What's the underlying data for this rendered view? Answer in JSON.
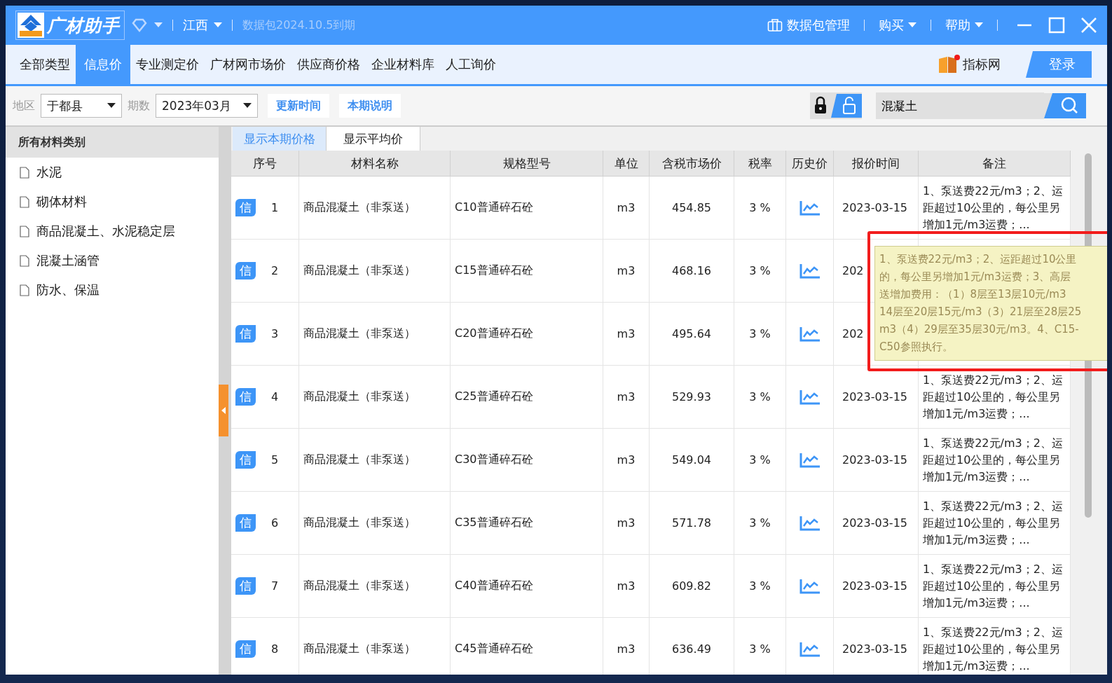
{
  "app": {
    "logo_text": "广材助手",
    "region": "江西",
    "package_notice": "数据包2024.10.5到期",
    "menu": [
      {
        "label": "数据包管理",
        "kind": "icon"
      },
      {
        "label": "购买",
        "kind": "dropdown"
      },
      {
        "label": "帮助",
        "kind": "dropdown"
      }
    ]
  },
  "nav": {
    "tabs": [
      {
        "label": "全部类型",
        "selected": false
      },
      {
        "label": "信息价",
        "selected": true
      },
      {
        "label": "专业测定价",
        "selected": false
      },
      {
        "label": "广材网市场价",
        "selected": false
      },
      {
        "label": "供应商价格",
        "selected": false
      },
      {
        "label": "企业材料库",
        "selected": false
      },
      {
        "label": "人工询价",
        "selected": false
      }
    ],
    "index_link": "指标网",
    "login": "登录"
  },
  "filters": {
    "region_label": "地区",
    "region": "于都县",
    "period_label": "期数",
    "period": "2023年03月",
    "buttons": [
      "更新时间",
      "本期说明"
    ],
    "search": "混凝土"
  },
  "sidebar": {
    "title": "所有材料类别",
    "items": [
      "水泥",
      "砌体材料",
      "商品混凝土、水泥稳定层",
      "混凝土涵管",
      "防水、保温"
    ]
  },
  "view_tabs": [
    {
      "label": "显示本期价格",
      "selected": true
    },
    {
      "label": "显示平均价",
      "selected": false
    }
  ],
  "table": {
    "columns": [
      "序号",
      "材料名称",
      "规格型号",
      "单位",
      "含税市场价",
      "税率",
      "历史价",
      "报价时间",
      "备注"
    ],
    "rows": [
      {
        "badge": "信",
        "seq": "1",
        "name": "商品混凝土（非泵送）",
        "spec": "C10普通碎石砼",
        "unit": "m3",
        "price": "454.85",
        "tax": "3 %",
        "time": "2023-03-15",
        "note": "1、泵送费22元/m3；2、运距超过10公里的，每公里另增加1元/m3运费；..."
      },
      {
        "badge": "信",
        "seq": "2",
        "name": "商品混凝土（非泵送）",
        "spec": "C15普通碎石砼",
        "unit": "m3",
        "price": "468.16",
        "tax": "3 %",
        "time": "202"
      },
      {
        "badge": "信",
        "seq": "3",
        "name": "商品混凝土（非泵送）",
        "spec": "C20普通碎石砼",
        "unit": "m3",
        "price": "495.64",
        "tax": "3 %",
        "time": "202"
      },
      {
        "badge": "信",
        "seq": "4",
        "name": "商品混凝土（非泵送）",
        "spec": "C25普通碎石砼",
        "unit": "m3",
        "price": "529.93",
        "tax": "3 %",
        "time": "2023-03-15",
        "note": "1、泵送费22元/m3；2、运距超过10公里的，每公里另增加1元/m3运费；..."
      },
      {
        "badge": "信",
        "seq": "5",
        "name": "商品混凝土（非泵送）",
        "spec": "C30普通碎石砼",
        "unit": "m3",
        "price": "549.04",
        "tax": "3 %",
        "time": "2023-03-15",
        "note": "1、泵送费22元/m3；2、运距超过10公里的，每公里另增加1元/m3运费；..."
      },
      {
        "badge": "信",
        "seq": "6",
        "name": "商品混凝土（非泵送）",
        "spec": "C35普通碎石砼",
        "unit": "m3",
        "price": "571.78",
        "tax": "3 %",
        "time": "2023-03-15",
        "note": "1、泵送费22元/m3；2、运距超过10公里的，每公里另增加1元/m3运费；..."
      },
      {
        "badge": "信",
        "seq": "7",
        "name": "商品混凝土（非泵送）",
        "spec": "C40普通碎石砼",
        "unit": "m3",
        "price": "609.82",
        "tax": "3 %",
        "time": "2023-03-15",
        "note": "1、泵送费22元/m3；2、运距超过10公里的，每公里另增加1元/m3运费；..."
      },
      {
        "badge": "信",
        "seq": "8",
        "name": "商品混凝土（非泵送）",
        "spec": "C45普通碎石砼",
        "unit": "m3",
        "price": "636.49",
        "tax": "3 %",
        "time": "2023-03-15",
        "note": "1、泵送费22元/m3；2、运距超过10公里的，每公里另增加1元/m3运费；..."
      }
    ]
  },
  "tooltip": {
    "lines": [
      "1、泵送费22元/m3；2、运距超过10公里",
      "的，每公里另增加1元/m3运费；3、高层",
      "送增加费用：（1）8层至13层10元/m3",
      "14层至20层15元/m3（3）21层至28层25",
      "m3（4）29层至35层30元/m3。4、C15-",
      "C50参照执行。"
    ]
  }
}
